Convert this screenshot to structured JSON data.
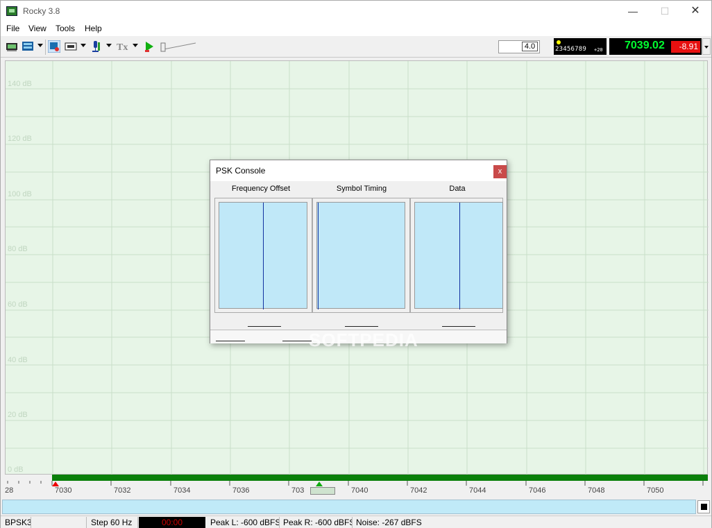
{
  "window": {
    "title": "Rocky 3.8"
  },
  "menu": {
    "file": "File",
    "view": "View",
    "tools": "Tools",
    "help": "Help"
  },
  "toolbar": {
    "speed_value": "4.0",
    "digits_display": "23456789",
    "digits_offset": "+20",
    "frequency": "7039.02",
    "frequency_offset": "-8.91"
  },
  "spectrum": {
    "db_labels": [
      "140 dB",
      "120 dB",
      "100 dB",
      "80 dB",
      "60 dB",
      "40 dB",
      "20 dB",
      "0 dB"
    ],
    "freq_labels": [
      "28",
      "7030",
      "7032",
      "7034",
      "7036",
      "703",
      "7040",
      "7042",
      "7044",
      "7046",
      "7048",
      "7050"
    ]
  },
  "psk_console": {
    "title": "PSK Console",
    "close_label": "x",
    "columns": [
      "Frequency Offset",
      "Symbol Timing",
      "Data"
    ]
  },
  "status": {
    "mode": "BPSK3",
    "step": "Step 60 Hz",
    "time": "00:00",
    "peak_l": "Peak L: -600 dBFS",
    "peak_r": "Peak R: -600 dBFS",
    "noise": "Noise: -267 dBFS"
  },
  "watermark": "SOFTPEDIA",
  "colors": {
    "spectrum_bg": "#e7f5e7",
    "signal_bar": "#0a800a",
    "frequency_text": "#00ff30",
    "frequency_offset_bg": "#e81010",
    "plot_bg": "#c0e8f8",
    "plot_line": "#1030a0"
  }
}
